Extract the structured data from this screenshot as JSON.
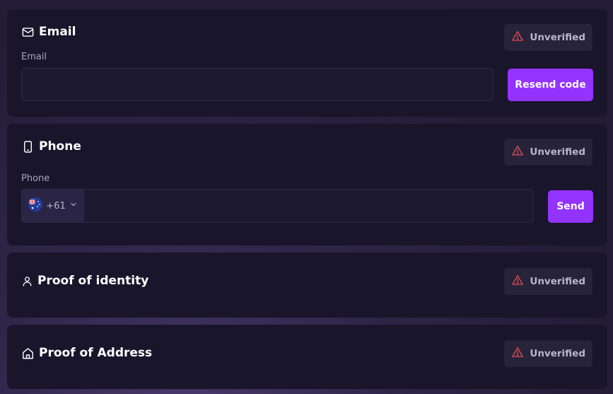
{
  "email": {
    "title": "Email",
    "status": "Unverified",
    "field_label": "Email",
    "value": "",
    "button": "Resend code"
  },
  "phone": {
    "title": "Phone",
    "status": "Unverified",
    "field_label": "Phone",
    "country_code": "+61",
    "country_flag": "australia-flag-icon",
    "value": "",
    "button": "Send"
  },
  "identity": {
    "title": "Proof of identity",
    "status": "Unverified"
  },
  "address": {
    "title": "Proof of Address",
    "status": "Unverified"
  },
  "colors": {
    "accent": "#9333ff",
    "warning": "#e5484d",
    "card_bg": "#19152b"
  }
}
